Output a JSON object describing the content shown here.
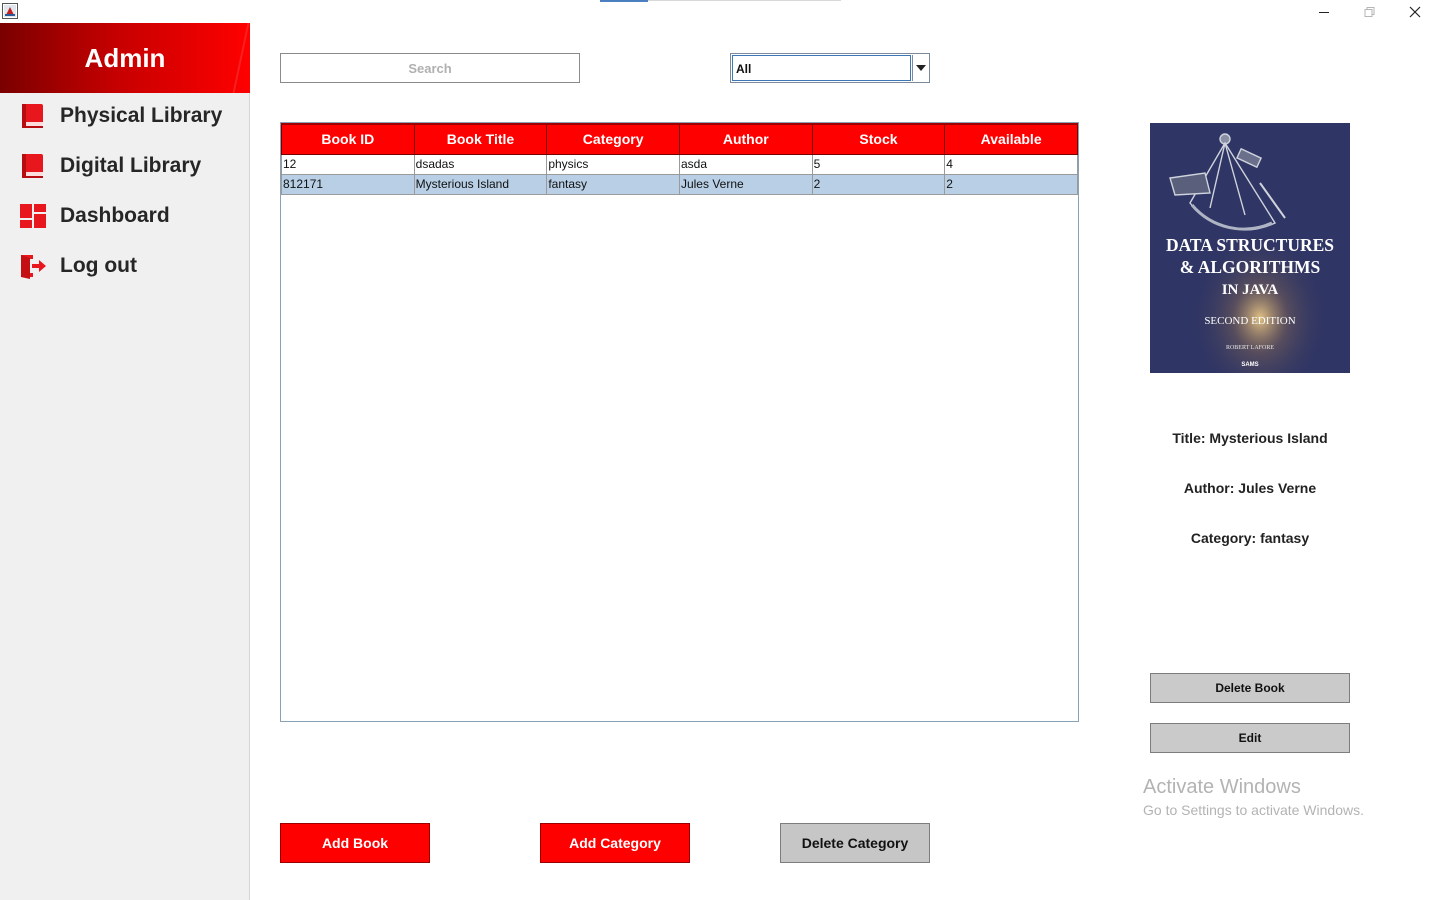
{
  "sidebar": {
    "title": "Admin",
    "items": [
      {
        "label": "Physical Library",
        "icon": "book-icon"
      },
      {
        "label": "Digital Library",
        "icon": "book-icon"
      },
      {
        "label": "Dashboard",
        "icon": "dashboard-icon"
      },
      {
        "label": "Log out",
        "icon": "logout-icon"
      }
    ]
  },
  "search": {
    "placeholder": "Search"
  },
  "filter": {
    "selected": "All"
  },
  "table": {
    "columns": [
      "Book ID",
      "Book Title",
      "Category",
      "Author",
      "Stock",
      "Available"
    ],
    "rows": [
      {
        "id": "12",
        "title": "dsadas",
        "category": "physics",
        "author": "asda",
        "stock": "5",
        "available": "4"
      },
      {
        "id": "812171",
        "title": "Mysterious Island",
        "category": "fantasy",
        "author": "Jules Verne",
        "stock": "2",
        "available": "2"
      }
    ],
    "selected_row": 1
  },
  "cover": {
    "line1": "DATA STRUCTURES",
    "line2": "& ALGORITHMS",
    "line3": "IN JAVA",
    "edition": "SECOND EDITION",
    "author": "ROBERT LAFORE",
    "publisher": "SAMS"
  },
  "details": {
    "title": "Title: Mysterious Island",
    "author": "Author: Jules Verne",
    "category": "Category: fantasy"
  },
  "buttons": {
    "delete_book": "Delete Book",
    "edit": "Edit",
    "add_book": "Add Book",
    "add_category": "Add Category",
    "delete_category": "Delete Category"
  },
  "watermark": {
    "title": "Activate Windows",
    "subtitle": "Go to Settings to activate Windows."
  },
  "colors": {
    "accent": "#ff0000",
    "selected_row": "#b8cfe5",
    "sidebar_bg": "#f0f0f0"
  }
}
